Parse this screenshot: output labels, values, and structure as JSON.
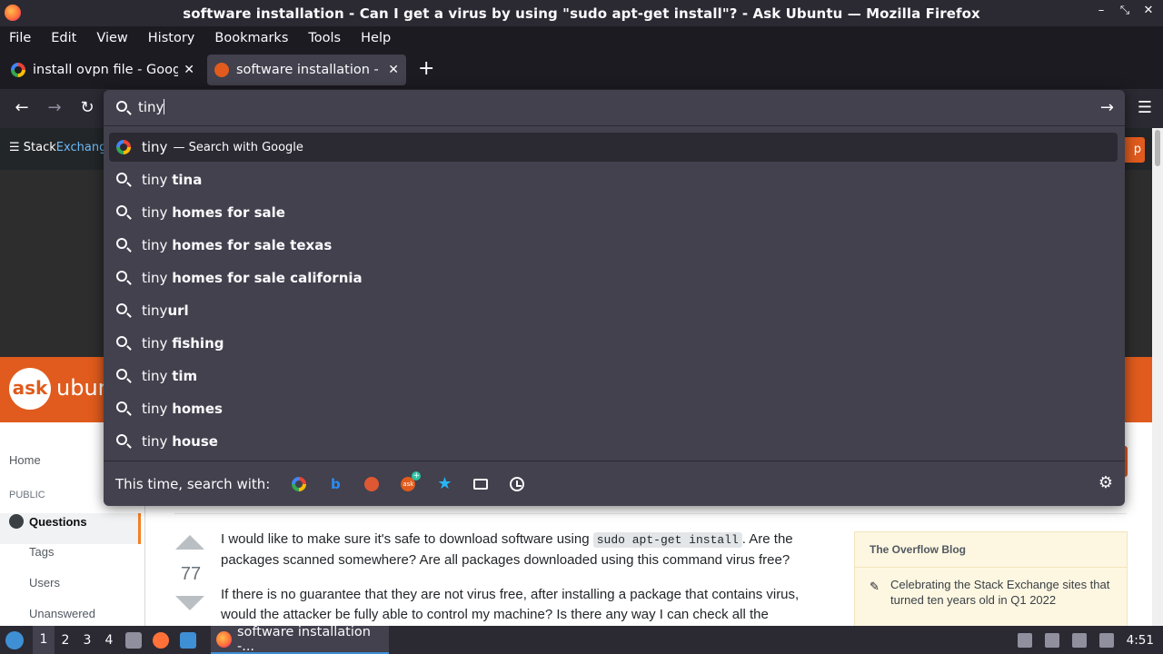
{
  "window": {
    "title": "software installation - Can I get a virus by using \"sudo apt-get install\"? - Ask Ubuntu — Mozilla Firefox",
    "controls": [
      "–",
      "⤡",
      "✕"
    ]
  },
  "menu": [
    "File",
    "Edit",
    "View",
    "History",
    "Bookmarks",
    "Tools",
    "Help"
  ],
  "tabs": [
    {
      "label": "install ovpn file - Google",
      "favicon": "google-icon",
      "active": false
    },
    {
      "label": "software installation - Ca",
      "favicon": "askubuntu-icon",
      "active": true
    }
  ],
  "newtab_label": "+",
  "nav": {
    "back": "←",
    "forward": "→",
    "reload": "↻",
    "menu": "☰"
  },
  "urlbar": {
    "value": "tiny",
    "go": "→",
    "suggestions": [
      {
        "typed": "tiny",
        "rest": "",
        "action": "— Search with Google",
        "icon": "google-icon",
        "selected": true
      },
      {
        "typed": "tiny ",
        "rest": "tina",
        "icon": "search-icon"
      },
      {
        "typed": "tiny ",
        "rest": "homes for sale",
        "icon": "search-icon"
      },
      {
        "typed": "tiny ",
        "rest": "homes for sale texas",
        "icon": "search-icon"
      },
      {
        "typed": "tiny ",
        "rest": "homes for sale california",
        "icon": "search-icon"
      },
      {
        "typed": "tiny",
        "rest": "url",
        "icon": "search-icon"
      },
      {
        "typed": "tiny ",
        "rest": "fishing",
        "icon": "search-icon"
      },
      {
        "typed": "tiny ",
        "rest": "tim",
        "icon": "search-icon"
      },
      {
        "typed": "tiny ",
        "rest": "homes",
        "icon": "search-icon"
      },
      {
        "typed": "tiny ",
        "rest": "house",
        "icon": "search-icon"
      }
    ],
    "oneoff_label": "This time, search with:",
    "engines": [
      "google-icon",
      "bing-icon",
      "duckduckgo-icon",
      "askubuntu-add-icon",
      "bookmarks-star-icon",
      "tabs-icon",
      "history-clock-icon"
    ],
    "settings_icon": "gear-icon"
  },
  "page": {
    "stackexchange": {
      "stack": "Stack",
      "exchange": "Exchange"
    },
    "orange_btn": "p",
    "ask_logo": {
      "circle": "ask",
      "word": "ubun"
    },
    "leftnav": {
      "home": "Home",
      "public": "PUBLIC",
      "questions": "Questions",
      "tags": "Tags",
      "users": "Users",
      "unanswered": "Unanswered"
    },
    "vote_score": "77",
    "question": {
      "p1_a": "I would like to make sure it's safe to download software using ",
      "p1_code": "sudo apt-get install",
      "p1_b": ". Are the packages scanned somewhere? Are all packages downloaded using this command virus free?",
      "p2": "If there is no guarantee that they are not virus free, after installing a package that contains virus, would the attacker be fully able to control my machine? Is there any way I can check all the"
    },
    "blog": {
      "heading": "The Overflow Blog",
      "item1": "Celebrating the Stack Exchange sites that turned ten years old in Q1 2022"
    }
  },
  "taskbar": {
    "workspaces": [
      "1",
      "2",
      "3",
      "4"
    ],
    "current_workspace": "1",
    "task_label": "software installation -...",
    "clock": "4:51"
  },
  "colors": {
    "accent": "#e05b1d",
    "toolbar": "#2b2a33",
    "popup": "#42414d"
  }
}
